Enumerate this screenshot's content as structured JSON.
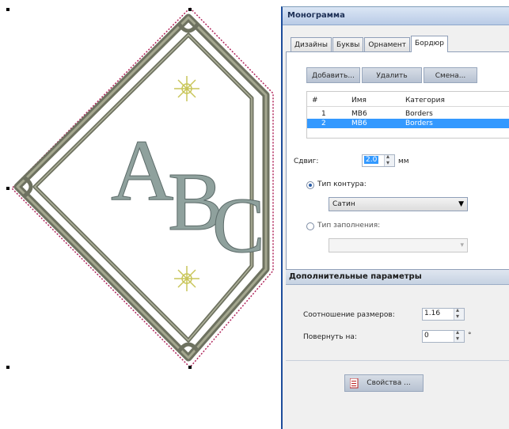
{
  "canvas": {
    "monogram_letters": [
      "A",
      "B",
      "C"
    ]
  },
  "panel": {
    "title": "Монограмма",
    "tabs": [
      {
        "label": "Дизайны",
        "active": false
      },
      {
        "label": "Буквы",
        "active": false
      },
      {
        "label": "Орнамент",
        "active": false
      },
      {
        "label": "Бордюр",
        "active": true
      }
    ],
    "buttons": {
      "add": "Добавить...",
      "delete": "Удалить",
      "change": "Смена..."
    },
    "list": {
      "columns": [
        "#",
        "Имя",
        "Категория"
      ],
      "rows": [
        {
          "num": "1",
          "name": "MB6",
          "category": "Borders",
          "selected": false
        },
        {
          "num": "2",
          "name": "MB6",
          "category": "Borders",
          "selected": true
        }
      ]
    },
    "offset": {
      "label": "Сдвиг:",
      "value": "2.0",
      "unit": "мм"
    },
    "contour": {
      "label": "Тип контура:",
      "selected": true,
      "value": "Сатин"
    },
    "fill": {
      "label": "Тип заполнения:",
      "selected": false,
      "value": ""
    },
    "section_title": "Дополнительные параметры",
    "size_ratio": {
      "label": "Соотношение размеров:",
      "value": "1.16"
    },
    "rotate": {
      "label": "Повернуть на:",
      "value": "0",
      "unit": "°"
    },
    "properties_button": "Свойства ..."
  },
  "colors": {
    "border_stitch": "#6e7260",
    "letters": "#8fa19d",
    "ornament": "#c9c65a",
    "dashed_outline": "#b0245a",
    "selection_blue": "#3399ff"
  }
}
